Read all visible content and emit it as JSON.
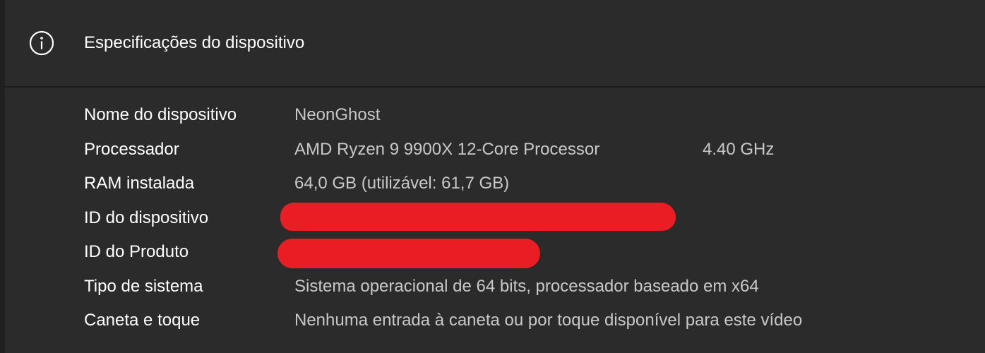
{
  "section": {
    "title": "Especificações do dispositivo",
    "icon": "info-icon"
  },
  "specs": [
    {
      "label": "Nome do dispositivo",
      "value": "NeonGhost"
    },
    {
      "label": "Processador",
      "value": "AMD Ryzen 9 9900X 12-Core Processor",
      "extra": "4.40 GHz"
    },
    {
      "label": "RAM instalada",
      "value": "64,0 GB (utilizável: 61,7 GB)"
    },
    {
      "label": "ID do dispositivo",
      "value": ""
    },
    {
      "label": "ID do Produto",
      "value": ""
    },
    {
      "label": "Tipo de sistema",
      "value": "Sistema operacional de 64 bits, processador baseado em x64"
    },
    {
      "label": "Caneta e toque",
      "value": "Nenhuma entrada à caneta ou por toque disponível para este vídeo"
    }
  ],
  "colors": {
    "background": "#2b2b2b",
    "text": "#ffffff",
    "value_text": "#c8c8c8",
    "redaction": "#ea1c24"
  }
}
